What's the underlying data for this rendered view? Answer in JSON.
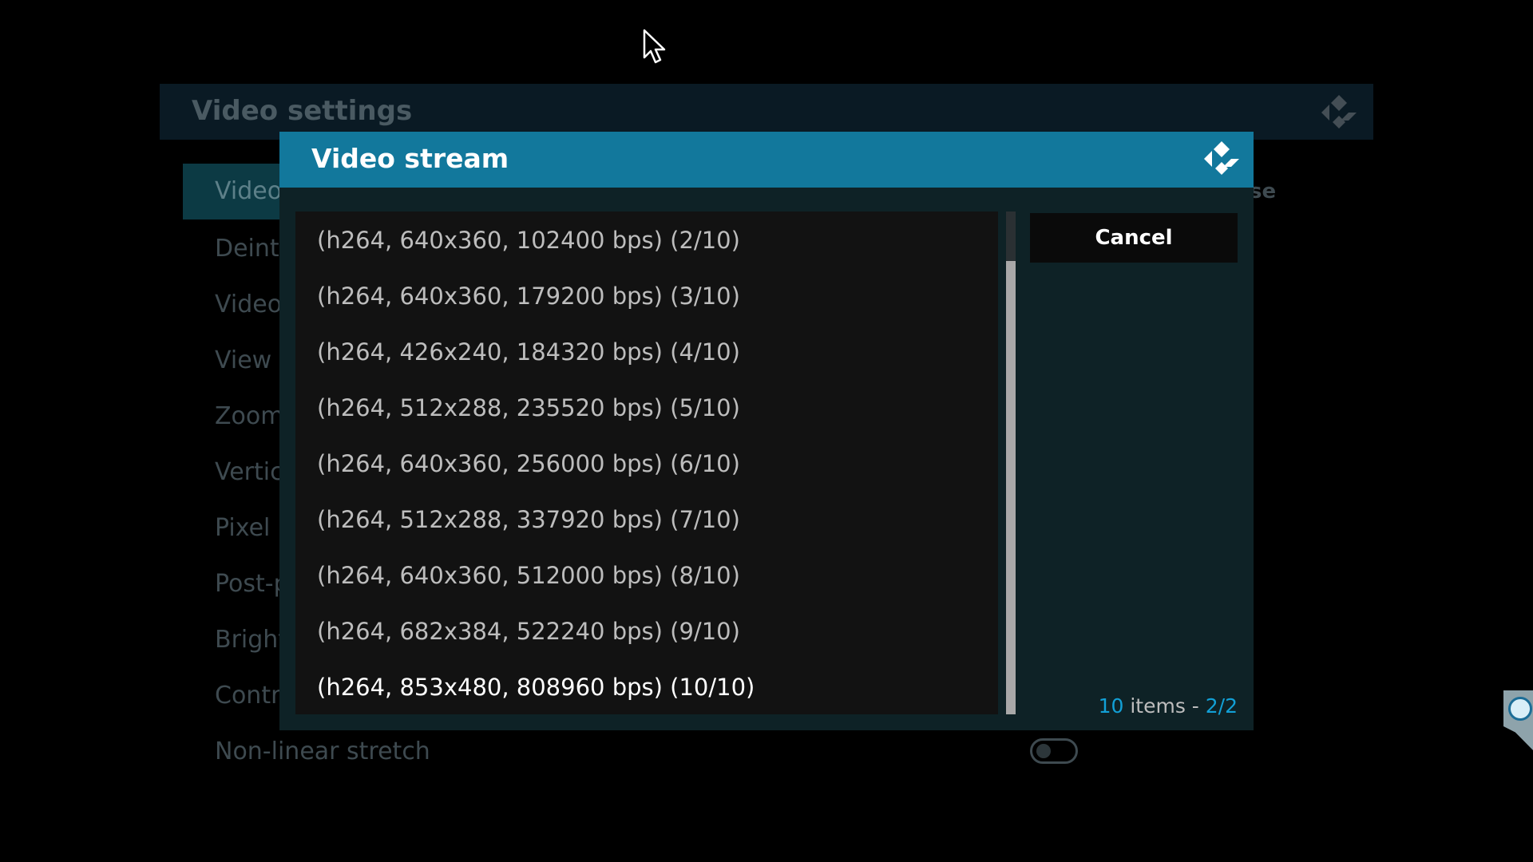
{
  "background": {
    "title": "Video settings",
    "items": [
      {
        "label": "Video"
      },
      {
        "label": "Deint"
      },
      {
        "label": "Video"
      },
      {
        "label": "View r"
      },
      {
        "label": "Zoom"
      },
      {
        "label": "Vertica"
      },
      {
        "label": "Pixel r"
      },
      {
        "label": "Post-p"
      },
      {
        "label": "Bright"
      },
      {
        "label": "Contra"
      },
      {
        "label": "Non-linear stretch"
      }
    ],
    "close_fragment": "se"
  },
  "dialog": {
    "title": "Video stream",
    "cancel_label": "Cancel",
    "items": [
      "(h264, 640x360, 102400 bps) (2/10)",
      "(h264, 640x360, 179200 bps) (3/10)",
      "(h264, 426x240, 184320 bps) (4/10)",
      "(h264, 512x288, 235520 bps) (5/10)",
      "(h264, 640x360, 256000 bps) (6/10)",
      "(h264, 512x288, 337920 bps) (7/10)",
      "(h264, 640x360, 512000 bps) (8/10)",
      "(h264, 682x384, 522240 bps) (9/10)",
      "(h264, 853x480, 808960 bps) (10/10)"
    ],
    "focused_index": 8,
    "count": "10",
    "count_label": " items - ",
    "page": "2/2"
  },
  "colors": {
    "header": "#12789c",
    "accent": "#12a0d6",
    "dialog_bg": "#0e2226",
    "list_bg": "#121212"
  },
  "icons": [
    "kodi-logo-icon",
    "mouse-cursor-icon",
    "teamviewer-icon"
  ]
}
